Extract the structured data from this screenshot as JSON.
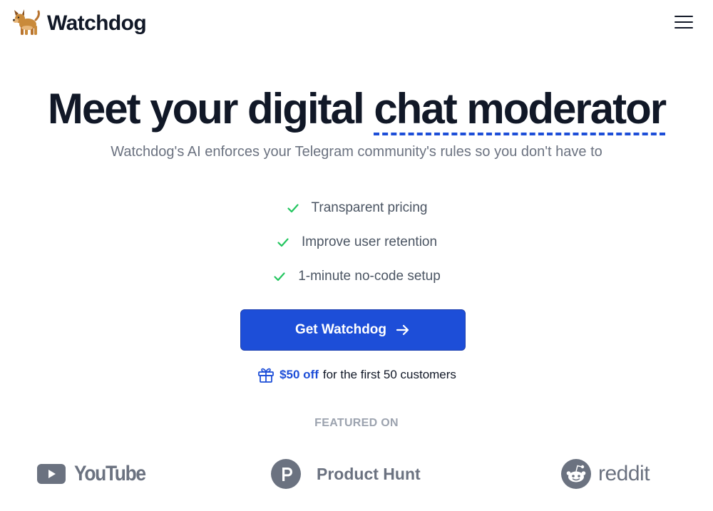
{
  "header": {
    "brand_name": "Watchdog",
    "logo_icon": "dog-emoji-icon",
    "menu_icon": "hamburger-menu-icon"
  },
  "hero": {
    "headline_prefix": "Meet your digital",
    "headline_highlight": "chat moderator",
    "subheadline": "Watchdog's AI enforces your Telegram community's rules so you don't have to"
  },
  "features": [
    {
      "label": "Transparent pricing",
      "icon": "check-icon"
    },
    {
      "label": "Improve user retention",
      "icon": "check-icon"
    },
    {
      "label": "1-minute no-code setup",
      "icon": "check-icon"
    }
  ],
  "cta": {
    "label": "Get Watchdog",
    "icon": "arrow-right-icon"
  },
  "promo": {
    "icon": "gift-icon",
    "offer": "$50 off",
    "text": "for the first 50 customers"
  },
  "featured": {
    "label": "FEATURED ON",
    "logos": [
      {
        "name": "YouTube",
        "icon": "youtube-icon"
      },
      {
        "name": "Product Hunt",
        "icon": "product-hunt-icon"
      },
      {
        "name": "reddit",
        "icon": "reddit-icon"
      }
    ]
  },
  "colors": {
    "primary": "#1d4ed8",
    "text": "#111827",
    "muted": "#6b7280",
    "check": "#22c55e",
    "featured_label": "#9ca3af"
  }
}
